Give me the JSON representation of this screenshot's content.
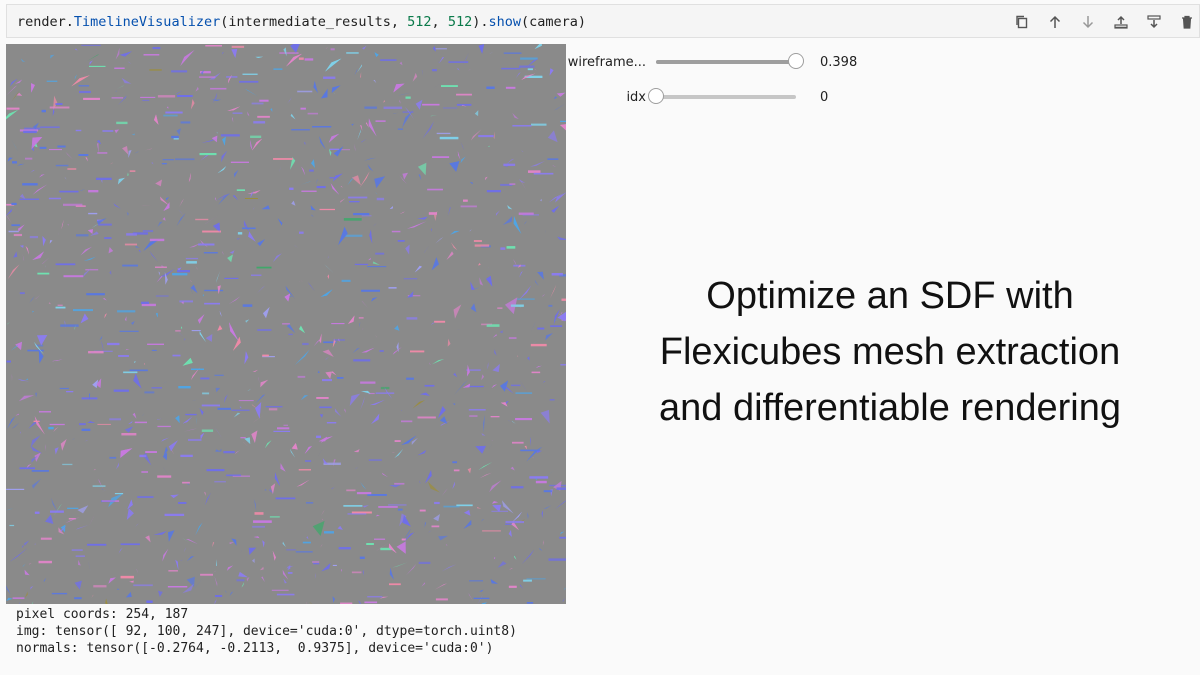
{
  "code_cell": {
    "prefix": "render.",
    "class_name": "TimelineVisualizer",
    "args_open": "(intermediate_results, ",
    "arg_w": "512",
    "sep": ", ",
    "arg_h": "512",
    "args_close": ").",
    "method": "show",
    "method_args": "(camera)"
  },
  "toolbar": {
    "icons": [
      "copy-icon",
      "arrow-up-icon",
      "arrow-down-icon",
      "insert-above-icon",
      "insert-below-icon",
      "delete-icon"
    ]
  },
  "widgets": {
    "wireframe": {
      "label": "wireframe...",
      "value": "0.398",
      "fraction": 1.0
    },
    "idx": {
      "label": "idx",
      "value": "0",
      "fraction": 0.0
    }
  },
  "readout": {
    "pixel_coords": "pixel coords: 254, 187",
    "img": "img: tensor([ 92, 100, 247], device='cuda:0', dtype=torch.uint8)",
    "normals": "normals: tensor([-0.2764, -0.2113,  0.9375], device='cuda:0')"
  },
  "caption": {
    "line1": "Optimize an SDF with",
    "line2": "Flexicubes mesh extraction",
    "line3": "and differentiable rendering"
  },
  "colors": {
    "background_gray": "#8a8a8a",
    "fragment_palette": [
      "#6f6fe8",
      "#8b7cf0",
      "#5a78e0",
      "#c77adf",
      "#e085c8",
      "#7fd0e8",
      "#6fe0b0",
      "#a0a0f5",
      "#f08aa8",
      "#4fa5e6",
      "#9c8e3a",
      "#3fa86a"
    ]
  }
}
